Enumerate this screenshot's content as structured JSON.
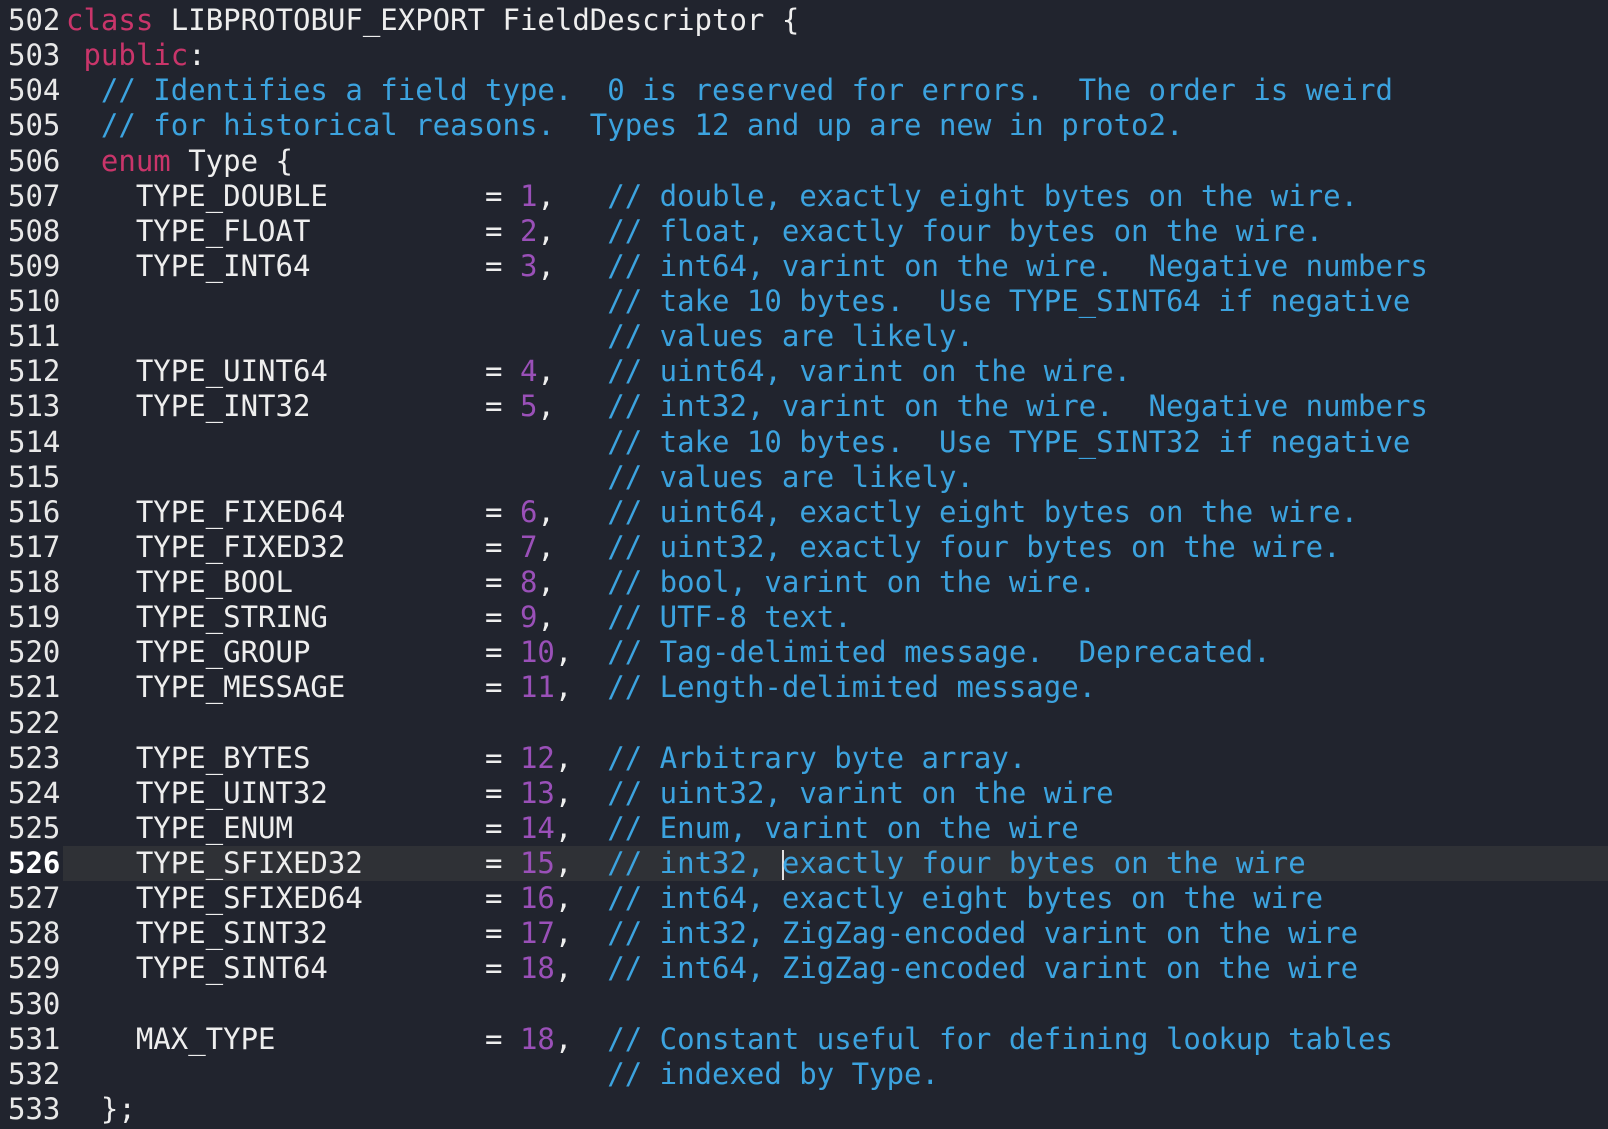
{
  "editor": {
    "current_line": 526,
    "cursor": {
      "line": 526,
      "column": 26
    },
    "colors": {
      "background": "#21242e",
      "keyword": "#c9356a",
      "comment": "#3ca3df",
      "number": "#9a50b8",
      "text": "#eeeeee",
      "current_line": "#2f3136"
    },
    "lines": [
      {
        "n": "502",
        "seg": [
          {
            "k": "kw",
            "v": "class"
          },
          {
            "k": "pl",
            "v": " LIBPROTOBUF_EXPORT FieldDescriptor {"
          }
        ]
      },
      {
        "n": "503",
        "seg": [
          {
            "k": "pl",
            "v": " "
          },
          {
            "k": "kw",
            "v": "public"
          },
          {
            "k": "pl",
            "v": ":"
          }
        ]
      },
      {
        "n": "504",
        "seg": [
          {
            "k": "pl",
            "v": "  "
          },
          {
            "k": "cm",
            "v": "// Identifies a field type.  0 is reserved for errors.  The order is weird"
          }
        ]
      },
      {
        "n": "505",
        "seg": [
          {
            "k": "pl",
            "v": "  "
          },
          {
            "k": "cm",
            "v": "// for historical reasons.  Types 12 and up are new in proto2."
          }
        ]
      },
      {
        "n": "506",
        "seg": [
          {
            "k": "pl",
            "v": "  "
          },
          {
            "k": "kw",
            "v": "enum"
          },
          {
            "k": "pl",
            "v": " Type {"
          }
        ]
      },
      {
        "n": "507",
        "seg": [
          {
            "k": "pl",
            "v": "    TYPE_DOUBLE         = "
          },
          {
            "k": "num",
            "v": "1"
          },
          {
            "k": "pl",
            "v": ",   "
          },
          {
            "k": "cm",
            "v": "// double, exactly eight bytes on the wire."
          }
        ]
      },
      {
        "n": "508",
        "seg": [
          {
            "k": "pl",
            "v": "    TYPE_FLOAT          = "
          },
          {
            "k": "num",
            "v": "2"
          },
          {
            "k": "pl",
            "v": ",   "
          },
          {
            "k": "cm",
            "v": "// float, exactly four bytes on the wire."
          }
        ]
      },
      {
        "n": "509",
        "seg": [
          {
            "k": "pl",
            "v": "    TYPE_INT64          = "
          },
          {
            "k": "num",
            "v": "3"
          },
          {
            "k": "pl",
            "v": ",   "
          },
          {
            "k": "cm",
            "v": "// int64, varint on the wire.  Negative numbers"
          }
        ]
      },
      {
        "n": "510",
        "seg": [
          {
            "k": "pl",
            "v": "                               "
          },
          {
            "k": "cm",
            "v": "// take 10 bytes.  Use TYPE_SINT64 if negative"
          }
        ]
      },
      {
        "n": "511",
        "seg": [
          {
            "k": "pl",
            "v": "                               "
          },
          {
            "k": "cm",
            "v": "// values are likely."
          }
        ]
      },
      {
        "n": "512",
        "seg": [
          {
            "k": "pl",
            "v": "    TYPE_UINT64         = "
          },
          {
            "k": "num",
            "v": "4"
          },
          {
            "k": "pl",
            "v": ",   "
          },
          {
            "k": "cm",
            "v": "// uint64, varint on the wire."
          }
        ]
      },
      {
        "n": "513",
        "seg": [
          {
            "k": "pl",
            "v": "    TYPE_INT32          = "
          },
          {
            "k": "num",
            "v": "5"
          },
          {
            "k": "pl",
            "v": ",   "
          },
          {
            "k": "cm",
            "v": "// int32, varint on the wire.  Negative numbers"
          }
        ]
      },
      {
        "n": "514",
        "seg": [
          {
            "k": "pl",
            "v": "                               "
          },
          {
            "k": "cm",
            "v": "// take 10 bytes.  Use TYPE_SINT32 if negative"
          }
        ]
      },
      {
        "n": "515",
        "seg": [
          {
            "k": "pl",
            "v": "                               "
          },
          {
            "k": "cm",
            "v": "// values are likely."
          }
        ]
      },
      {
        "n": "516",
        "seg": [
          {
            "k": "pl",
            "v": "    TYPE_FIXED64        = "
          },
          {
            "k": "num",
            "v": "6"
          },
          {
            "k": "pl",
            "v": ",   "
          },
          {
            "k": "cm",
            "v": "// uint64, exactly eight bytes on the wire."
          }
        ]
      },
      {
        "n": "517",
        "seg": [
          {
            "k": "pl",
            "v": "    TYPE_FIXED32        = "
          },
          {
            "k": "num",
            "v": "7"
          },
          {
            "k": "pl",
            "v": ",   "
          },
          {
            "k": "cm",
            "v": "// uint32, exactly four bytes on the wire."
          }
        ]
      },
      {
        "n": "518",
        "seg": [
          {
            "k": "pl",
            "v": "    TYPE_BOOL           = "
          },
          {
            "k": "num",
            "v": "8"
          },
          {
            "k": "pl",
            "v": ",   "
          },
          {
            "k": "cm",
            "v": "// bool, varint on the wire."
          }
        ]
      },
      {
        "n": "519",
        "seg": [
          {
            "k": "pl",
            "v": "    TYPE_STRING         = "
          },
          {
            "k": "num",
            "v": "9"
          },
          {
            "k": "pl",
            "v": ",   "
          },
          {
            "k": "cm",
            "v": "// UTF-8 text."
          }
        ]
      },
      {
        "n": "520",
        "seg": [
          {
            "k": "pl",
            "v": "    TYPE_GROUP          = "
          },
          {
            "k": "num",
            "v": "10"
          },
          {
            "k": "pl",
            "v": ",  "
          },
          {
            "k": "cm",
            "v": "// Tag-delimited message.  Deprecated."
          }
        ]
      },
      {
        "n": "521",
        "seg": [
          {
            "k": "pl",
            "v": "    TYPE_MESSAGE        = "
          },
          {
            "k": "num",
            "v": "11"
          },
          {
            "k": "pl",
            "v": ",  "
          },
          {
            "k": "cm",
            "v": "// Length-delimited message."
          }
        ]
      },
      {
        "n": "522",
        "seg": []
      },
      {
        "n": "523",
        "seg": [
          {
            "k": "pl",
            "v": "    TYPE_BYTES          = "
          },
          {
            "k": "num",
            "v": "12"
          },
          {
            "k": "pl",
            "v": ",  "
          },
          {
            "k": "cm",
            "v": "// Arbitrary byte array."
          }
        ]
      },
      {
        "n": "524",
        "seg": [
          {
            "k": "pl",
            "v": "    TYPE_UINT32         = "
          },
          {
            "k": "num",
            "v": "13"
          },
          {
            "k": "pl",
            "v": ",  "
          },
          {
            "k": "cm",
            "v": "// uint32, varint on the wire"
          }
        ]
      },
      {
        "n": "525",
        "seg": [
          {
            "k": "pl",
            "v": "    TYPE_ENUM           = "
          },
          {
            "k": "num",
            "v": "14"
          },
          {
            "k": "pl",
            "v": ",  "
          },
          {
            "k": "cm",
            "v": "// Enum, varint on the wire"
          }
        ]
      },
      {
        "n": "526",
        "seg": [
          {
            "k": "pl",
            "v": "    TYPE_SFIXED32       = "
          },
          {
            "k": "num",
            "v": "15"
          },
          {
            "k": "pl",
            "v": ",  "
          },
          {
            "k": "cm",
            "v": "// int32, "
          },
          {
            "k": "cursor",
            "v": ""
          },
          {
            "k": "cm",
            "v": "exactly four bytes on the wire"
          }
        ]
      },
      {
        "n": "527",
        "seg": [
          {
            "k": "pl",
            "v": "    TYPE_SFIXED64       = "
          },
          {
            "k": "num",
            "v": "16"
          },
          {
            "k": "pl",
            "v": ",  "
          },
          {
            "k": "cm",
            "v": "// int64, exactly eight bytes on the wire"
          }
        ]
      },
      {
        "n": "528",
        "seg": [
          {
            "k": "pl",
            "v": "    TYPE_SINT32         = "
          },
          {
            "k": "num",
            "v": "17"
          },
          {
            "k": "pl",
            "v": ",  "
          },
          {
            "k": "cm",
            "v": "// int32, ZigZag-encoded varint on the wire"
          }
        ]
      },
      {
        "n": "529",
        "seg": [
          {
            "k": "pl",
            "v": "    TYPE_SINT64         = "
          },
          {
            "k": "num",
            "v": "18"
          },
          {
            "k": "pl",
            "v": ",  "
          },
          {
            "k": "cm",
            "v": "// int64, ZigZag-encoded varint on the wire"
          }
        ]
      },
      {
        "n": "530",
        "seg": []
      },
      {
        "n": "531",
        "seg": [
          {
            "k": "pl",
            "v": "    MAX_TYPE            = "
          },
          {
            "k": "num",
            "v": "18"
          },
          {
            "k": "pl",
            "v": ",  "
          },
          {
            "k": "cm",
            "v": "// Constant useful for defining lookup tables"
          }
        ]
      },
      {
        "n": "532",
        "seg": [
          {
            "k": "pl",
            "v": "                               "
          },
          {
            "k": "cm",
            "v": "// indexed by Type."
          }
        ]
      },
      {
        "n": "533",
        "seg": [
          {
            "k": "pl",
            "v": "  };"
          }
        ]
      }
    ]
  }
}
